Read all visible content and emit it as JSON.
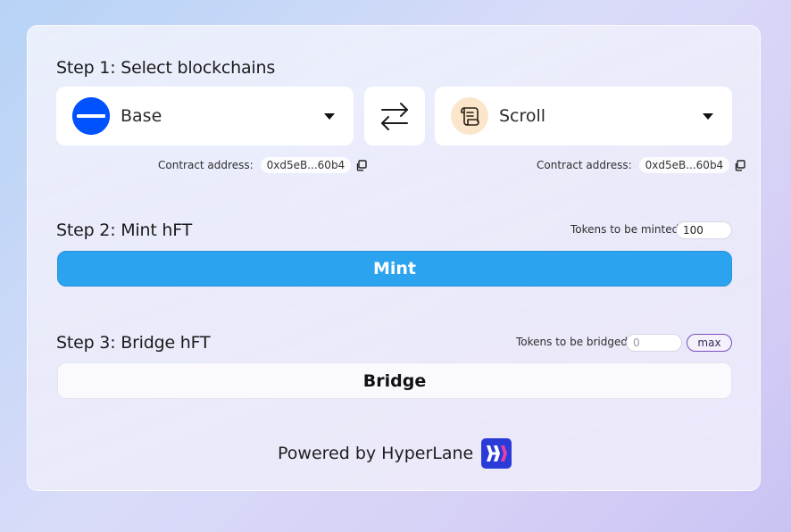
{
  "step1": {
    "title": "Step 1: Select blockchains",
    "source": {
      "chain": "Base",
      "logo_color": "#0052ff",
      "icon": "base-logo-icon",
      "contract_label": "Contract address:",
      "contract_address": "0xd5eB...60b4"
    },
    "destination": {
      "chain": "Scroll",
      "logo_color": "#fbe6cc",
      "icon": "scroll-logo-icon",
      "contract_label": "Contract address:",
      "contract_address": "0xd5eB...60b4"
    },
    "swap_icon": "swap-arrows-icon"
  },
  "step2": {
    "title": "Step 2: Mint hFT",
    "tokens_label": "Tokens to be minted",
    "tokens_value": "100",
    "button_label": "Mint",
    "button_color": "#2ca3ee"
  },
  "step3": {
    "title": "Step 3: Bridge hFT",
    "tokens_label": "Tokens to be bridged",
    "tokens_placeholder": "0",
    "max_label": "max",
    "button_label": "Bridge"
  },
  "footer": {
    "powered_by": "Powered by HyperLane",
    "logo_icon": "hyperlane-logo-icon",
    "logo_color": "#2a3bd8"
  }
}
